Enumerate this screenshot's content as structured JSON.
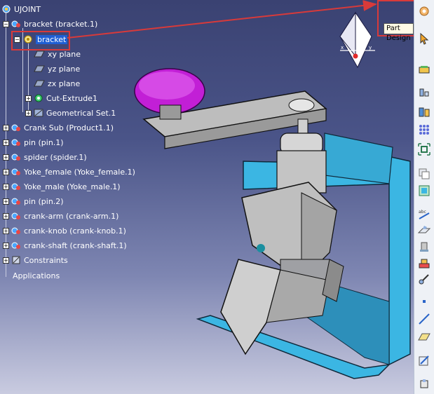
{
  "tree": {
    "root": "UJOINT",
    "items": [
      {
        "label": "bracket (bracket.1)"
      },
      {
        "label": "bracket",
        "selected": true
      },
      {
        "label": "xy plane"
      },
      {
        "label": "yz plane"
      },
      {
        "label": "zx plane"
      },
      {
        "label": "Cut-Extrude1"
      },
      {
        "label": "Geometrical Set.1"
      },
      {
        "label": "Crank Sub (Product1.1)"
      },
      {
        "label": "pin (pin.1)"
      },
      {
        "label": "spider (spider.1)"
      },
      {
        "label": "Yoke_female (Yoke_female.1)"
      },
      {
        "label": "Yoke_male (Yoke_male.1)"
      },
      {
        "label": "pin (pin.2)"
      },
      {
        "label": "crank-arm (crank-arm.1)"
      },
      {
        "label": "crank-knob (crank-knob.1)"
      },
      {
        "label": "crank-shaft (crank-shaft.1)"
      },
      {
        "label": "Constraints"
      },
      {
        "label": "Applications"
      }
    ]
  },
  "workbench": {
    "tooltip": "Part Design",
    "icon": "part-design-gear-icon"
  },
  "toolbar": {
    "icons": [
      "part-design-gear-icon",
      "select-arrow-icon",
      "surface-icon",
      "measure-icon",
      "boolean-icon",
      "pattern-icon",
      "fit-all-icon",
      "copy-icon",
      "frame-icon",
      "annotation-icon",
      "draft-icon",
      "paint-icon",
      "tools-icon",
      "constraint-icon",
      "point-icon",
      "line-icon",
      "plane-icon",
      "sketch-icon",
      "analysis-icon"
    ]
  },
  "colors": {
    "background_top": "#3a4272",
    "background_bottom": "#c9cbe0",
    "bracket": "#3bb6e3",
    "knob": "#c21fd6",
    "metal": "#c9c9c9",
    "highlight": "#d83a3a",
    "selection": "#1f5fd4"
  }
}
